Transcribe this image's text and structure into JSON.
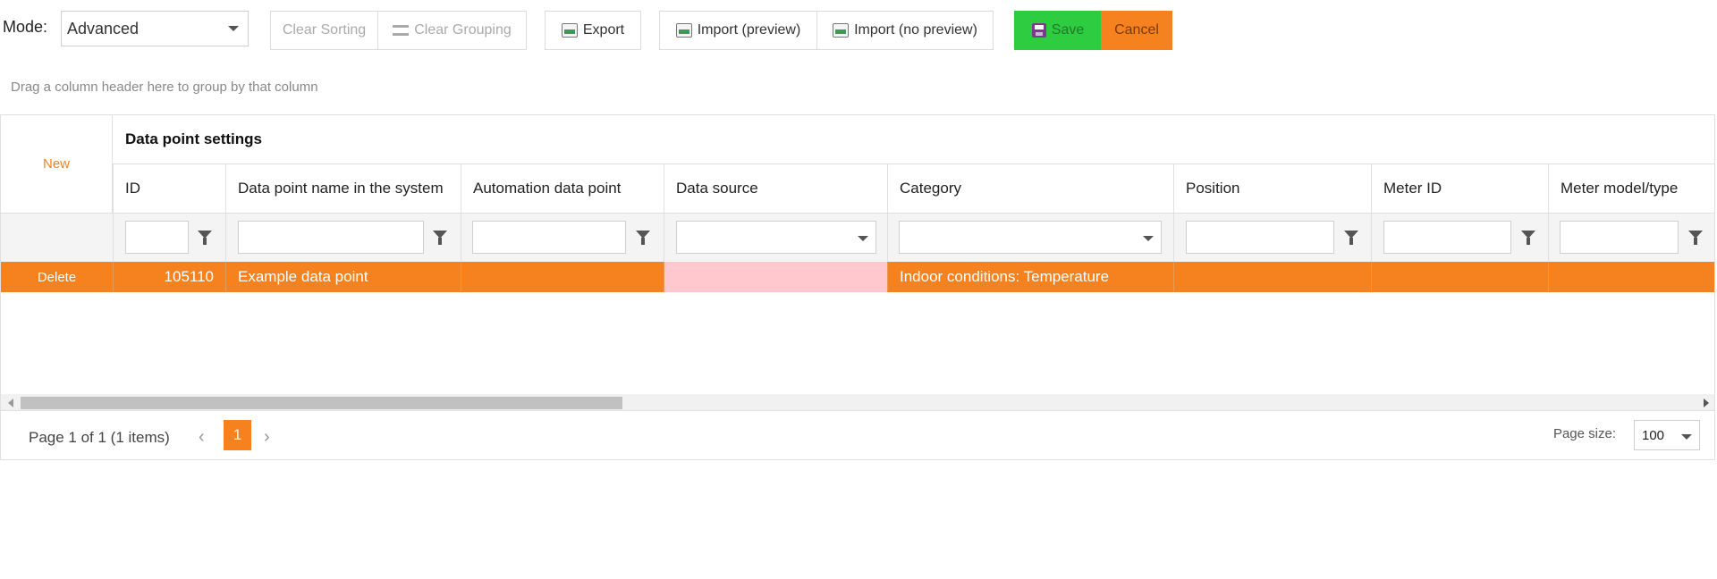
{
  "toolbar": {
    "mode_label": "Mode:",
    "mode_value": "Advanced",
    "clear_sorting": "Clear Sorting",
    "clear_grouping": "Clear Grouping",
    "export": "Export",
    "import_preview": "Import (preview)",
    "import_no_preview": "Import (no preview)",
    "save": "Save",
    "cancel": "Cancel"
  },
  "group_hint": "Drag a column header here to group by that column",
  "grid": {
    "new_label": "New",
    "band_title": "Data point settings",
    "columns": [
      "ID",
      "Data point name in the system",
      "Automation data point",
      "Data source",
      "Category",
      "Position",
      "Meter ID",
      "Meter model/type"
    ],
    "rows": [
      {
        "command": "Delete",
        "id": "105110",
        "name": "Example data point",
        "automation": "",
        "source": "",
        "category": "Indoor conditions: Temperature",
        "position": "",
        "meter_id": "",
        "meter_model": ""
      }
    ]
  },
  "pager": {
    "info": "Page 1 of 1 (1 items)",
    "current_page": "1",
    "page_size_label": "Page size:",
    "page_size_value": "100"
  },
  "colors": {
    "accent": "#f5821f",
    "save": "#2ecc40",
    "error_cell": "#ffc8cf"
  }
}
